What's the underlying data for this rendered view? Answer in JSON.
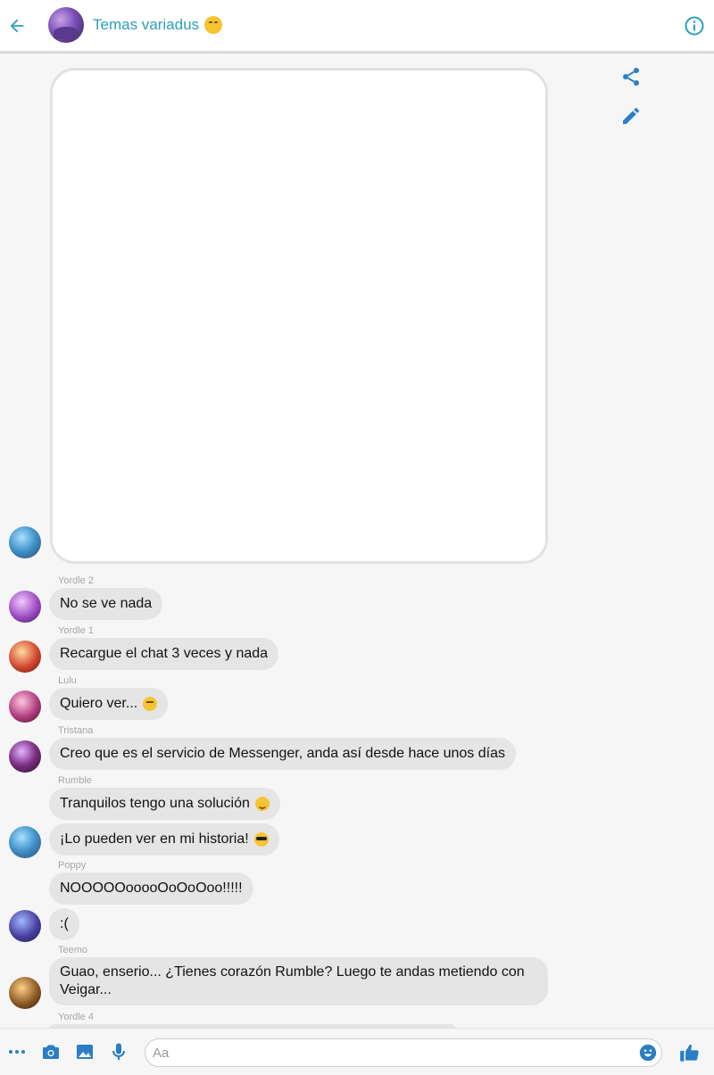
{
  "header": {
    "title": "Temas variadus",
    "back_icon": "arrow-left-icon",
    "info_icon": "info-icon",
    "accent_color": "#2a9fbd"
  },
  "side_actions": {
    "share_icon": "share-icon",
    "edit_icon": "pencil-icon"
  },
  "messages": [
    {
      "sender": "Yordle 2",
      "text": "No se ve nada"
    },
    {
      "sender": "Yordle 1",
      "text": "Recargue el chat 3 veces y nada"
    },
    {
      "sender": "Lulu",
      "text": "Quiero ver..."
    },
    {
      "sender": "Tristana",
      "text": "Creo que es el servicio de Messenger, anda así desde hace unos días"
    },
    {
      "sender": "Rumble",
      "text": "Tranquilos tengo una solución"
    },
    {
      "sender": "",
      "text": "¡Lo pueden ver en mi historia!"
    },
    {
      "sender": "Poppy",
      "text": "NOOOOOooooOoOoOoo!!!!!"
    },
    {
      "sender": "",
      "text": ":("
    },
    {
      "sender": "Teemo",
      "text": "Guao, enserio... ¿Tienes corazón Rumble? Luego te andas metiendo con Veigar..."
    },
    {
      "sender": "Yordle 4",
      "text": ""
    }
  ],
  "composer": {
    "placeholder": "Aa",
    "value": ""
  },
  "bottom_icons": [
    "more-icon",
    "camera-icon",
    "image-icon",
    "microphone-icon",
    "emoji-icon",
    "thumbs-up-icon"
  ]
}
